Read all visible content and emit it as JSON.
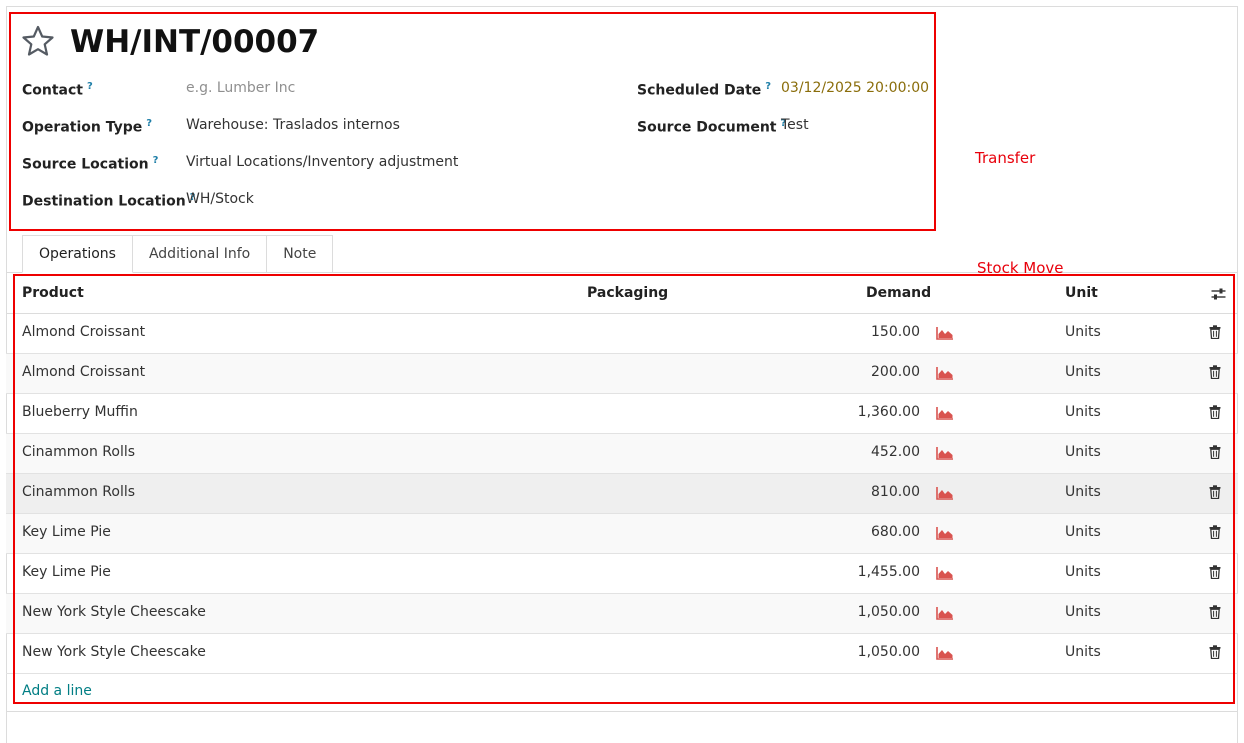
{
  "record": {
    "title": "WH/INT/00007"
  },
  "fields": {
    "contact": {
      "label": "Contact",
      "help": "?",
      "placeholder": "e.g. Lumber Inc"
    },
    "operation_type": {
      "label": "Operation Type",
      "help": "?",
      "value": "Warehouse: Traslados internos"
    },
    "source_location": {
      "label": "Source Location",
      "help": "?",
      "value": "Virtual Locations/Inventory adjustment"
    },
    "destination_location": {
      "label": "Destination Location",
      "help": "?",
      "value": "WH/Stock"
    },
    "scheduled_date": {
      "label": "Scheduled Date",
      "help": "?",
      "value": "03/12/2025 20:00:00"
    },
    "source_document": {
      "label": "Source Document",
      "help": "?",
      "value": "Test"
    }
  },
  "tabs": [
    {
      "label": "Operations",
      "active": true
    },
    {
      "label": "Additional Info",
      "active": false
    },
    {
      "label": "Note",
      "active": false
    }
  ],
  "table": {
    "columns": {
      "product": "Product",
      "packaging": "Packaging",
      "demand": "Demand",
      "unit": "Unit"
    },
    "rows": [
      {
        "product": "Almond Croissant",
        "packaging": "",
        "demand": "150.00",
        "unit": "Units"
      },
      {
        "product": "Almond Croissant",
        "packaging": "",
        "demand": "200.00",
        "unit": "Units"
      },
      {
        "product": "Blueberry Muffin",
        "packaging": "",
        "demand": "1,360.00",
        "unit": "Units"
      },
      {
        "product": "Cinammon Rolls",
        "packaging": "",
        "demand": "452.00",
        "unit": "Units"
      },
      {
        "product": "Cinammon Rolls",
        "packaging": "",
        "demand": "810.00",
        "unit": "Units"
      },
      {
        "product": "Key Lime Pie",
        "packaging": "",
        "demand": "680.00",
        "unit": "Units"
      },
      {
        "product": "Key Lime Pie",
        "packaging": "",
        "demand": "1,455.00",
        "unit": "Units"
      },
      {
        "product": "New York Style Cheescake",
        "packaging": "",
        "demand": "1,050.00",
        "unit": "Units"
      },
      {
        "product": "New York Style Cheescake",
        "packaging": "",
        "demand": "1,050.00",
        "unit": "Units"
      }
    ],
    "add_line": "Add a line"
  },
  "annotations": {
    "transfer": "Transfer",
    "stock_move": "Stock Move"
  },
  "colors": {
    "annotation": "#ee0000",
    "link": "#017e84",
    "help_marker": "#1f7fa8",
    "date_value": "#8a6d0b",
    "forecast_icon": "#d9534f"
  },
  "icons": {
    "favorite": "star-outline-icon",
    "forecast": "area-chart-icon",
    "delete": "trash-icon",
    "optional_columns": "sliders-icon"
  }
}
